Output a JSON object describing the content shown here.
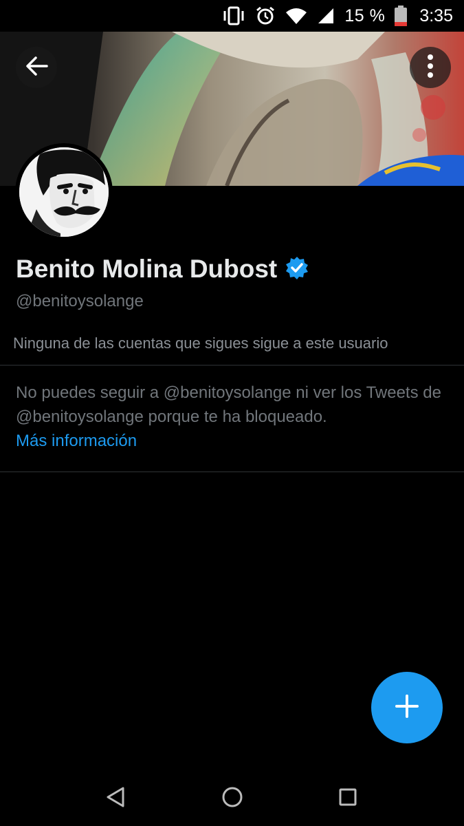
{
  "status_bar": {
    "battery_percent": "15 %",
    "time": "3:35",
    "icons": [
      "vibrate-icon",
      "alarm-icon",
      "wifi-icon",
      "cell-signal-icon",
      "battery-icon"
    ],
    "battery_color": "#e53935"
  },
  "header": {
    "back_icon": "arrow-left-icon",
    "more_icon": "more-vertical-icon"
  },
  "profile": {
    "display_name": "Benito Molina Dubost",
    "verified": true,
    "verified_color": "#1d9bf0",
    "handle": "@benitoysolange",
    "followers_note": "Ninguna de las cuentas que sigues sigue a este usuario"
  },
  "blocked": {
    "message": "No puedes seguir a @benitoysolange ni ver los Tweets de @benitoysolange porque te ha bloqueado.",
    "link_label": "Más información",
    "link_color": "#1d9bf0"
  },
  "fab": {
    "icon": "plus-icon",
    "color": "#1d9bf0"
  },
  "nav_bar": {
    "icons": [
      "nav-back-icon",
      "nav-home-icon",
      "nav-recents-icon"
    ]
  }
}
